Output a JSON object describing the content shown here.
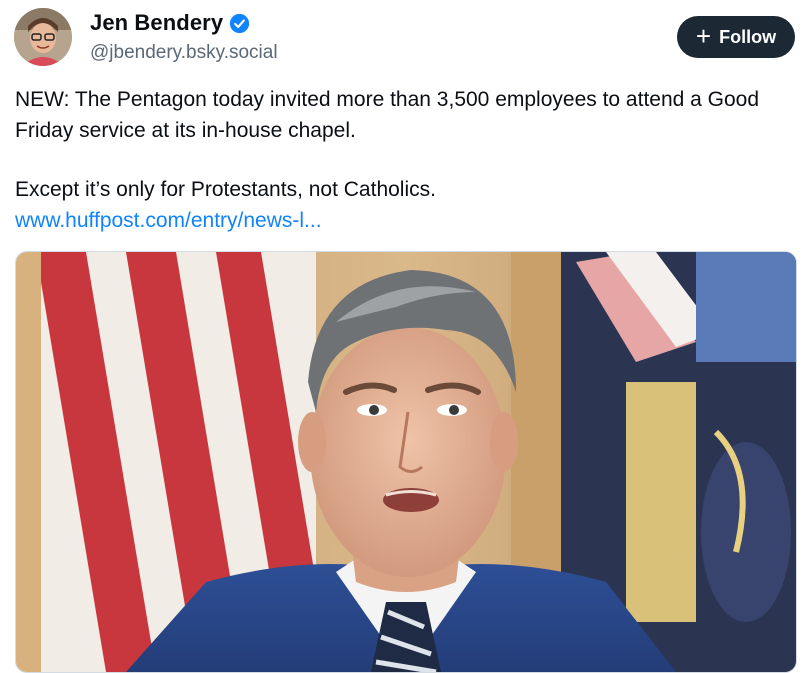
{
  "author": {
    "display_name": "Jen Bendery",
    "handle": "@jbendery.bsky.social",
    "verified": true,
    "avatar_icon": "avatar-photo"
  },
  "actions": {
    "follow_plus": "+",
    "follow_label": "Follow"
  },
  "post": {
    "paragraph_1": "NEW: The Pentagon today invited more than 3,500 employees to attend a Good Friday service at its in-house chapel.",
    "paragraph_2": "Except it’s only for Protestants, not Catholics.",
    "link_text": "www.huffpost.com/entry/news-l..."
  },
  "embed": {
    "image_subject": "man-in-suit-with-flags"
  },
  "colors": {
    "follow_bg": "#1c2935",
    "link": "#1083fe",
    "verified": "#1083fe",
    "handle": "#5b6876"
  }
}
